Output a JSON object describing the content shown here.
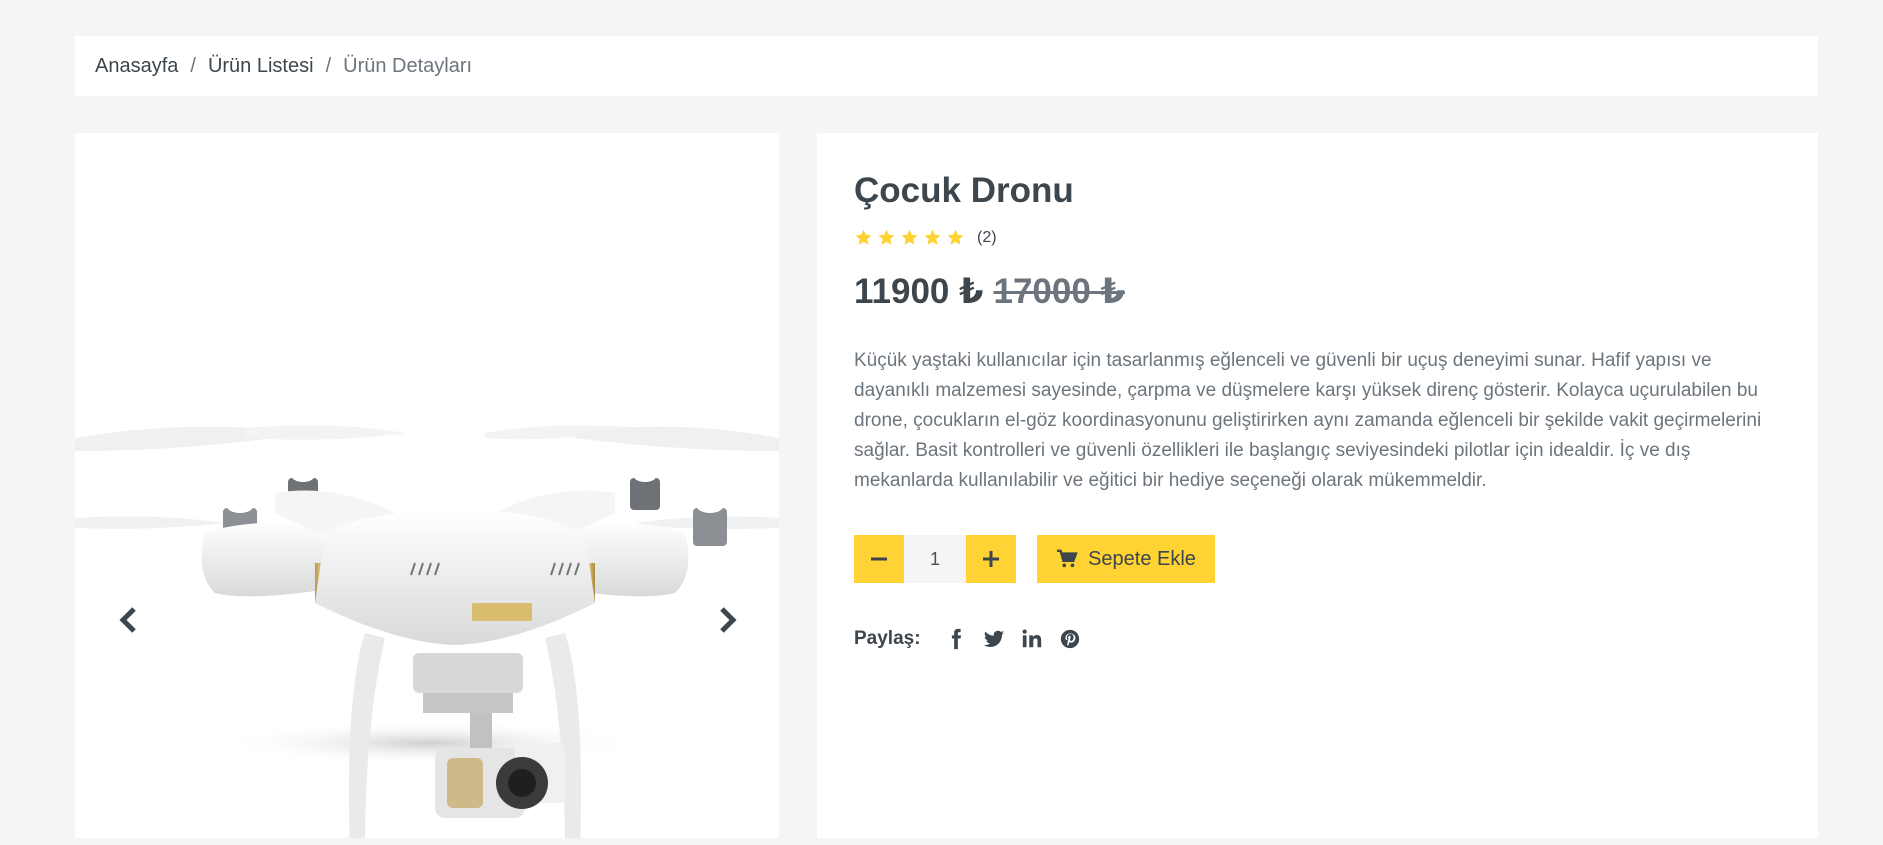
{
  "breadcrumb": {
    "home": "Anasayfa",
    "list": "Ürün Listesi",
    "current": "Ürün Detayları",
    "separator": "/"
  },
  "product": {
    "title": "Çocuk Dronu",
    "rating_stars": 5,
    "review_count": "(2)",
    "price": "11900 ₺",
    "old_price": "17000 ₺",
    "description": "Küçük yaştaki kullanıcılar için tasarlanmış eğlenceli ve güvenli bir uçuş deneyimi sunar. Hafif yapısı ve dayanıklı malzemesi sayesinde, çarpma ve düşmelere karşı yüksek direnç gösterir. Kolayca uçurulabilen bu drone, çocukların el-göz koordinasyonunu geliştirirken aynı zamanda eğlenceli bir şekilde vakit geçirmelerini sağlar. Basit kontrolleri ve güvenli özellikleri ile başlangıç seviyesindeki pilotlar için idealdir. İç ve dış mekanlarda kullanılabilir ve eğitici bir hediye seçeneği olarak mükemmeldir.",
    "quantity": "1"
  },
  "actions": {
    "add_to_cart": "Sepete Ekle"
  },
  "share": {
    "label": "Paylaş:",
    "networks": [
      "facebook-icon",
      "twitter-icon",
      "linkedin-icon",
      "pinterest-icon"
    ]
  },
  "colors": {
    "accent": "#ffd333",
    "text_dark": "#3d464d",
    "text_muted": "#6c757d",
    "background": "#f5f5f5",
    "star": "#ffd333"
  }
}
